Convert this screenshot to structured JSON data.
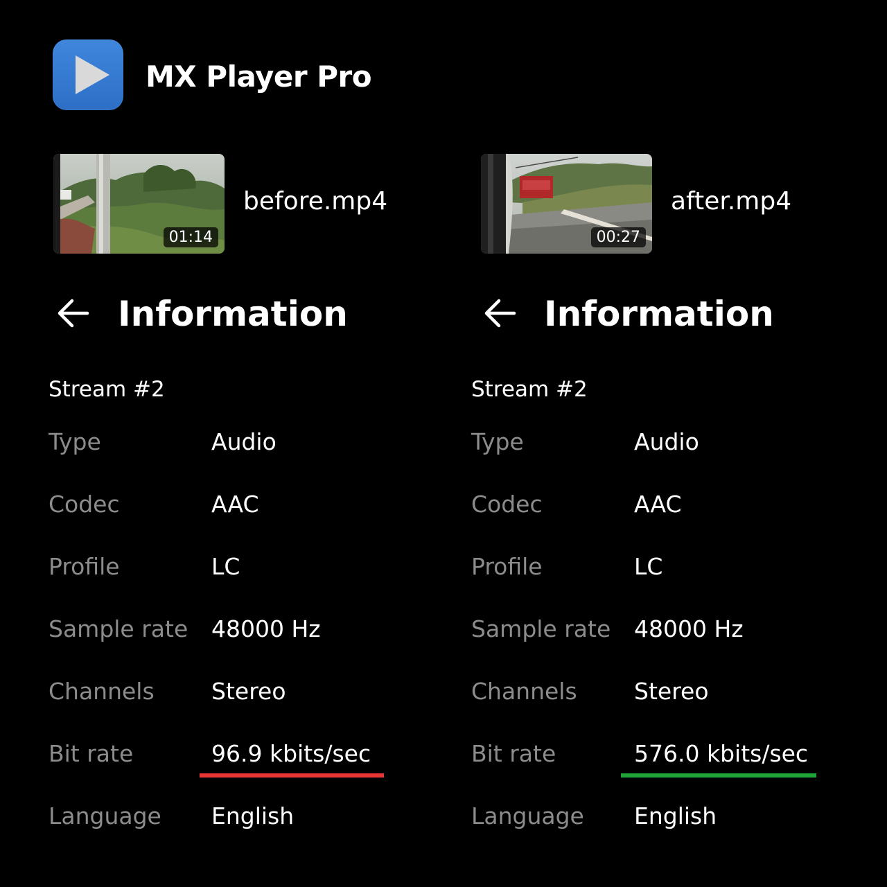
{
  "app": {
    "title": "MX Player Pro",
    "icon": "play-icon",
    "icon_color": "#3a7ed6"
  },
  "left": {
    "file_name": "before.mp4",
    "duration": "01:14",
    "header_title": "Information",
    "stream": "Stream #2",
    "rows": [
      {
        "label": "Type",
        "value": "Audio"
      },
      {
        "label": "Codec",
        "value": "AAC"
      },
      {
        "label": "Profile",
        "value": "LC"
      },
      {
        "label": "Sample rate",
        "value": "48000 Hz"
      },
      {
        "label": "Channels",
        "value": "Stereo"
      },
      {
        "label": "Bit rate",
        "value": "96.9 kbits/sec"
      },
      {
        "label": "Language",
        "value": "English"
      }
    ],
    "highlight_color": "#e83535"
  },
  "right": {
    "file_name": "after.mp4",
    "duration": "00:27",
    "header_title": "Information",
    "stream": "Stream #2",
    "rows": [
      {
        "label": "Type",
        "value": "Audio"
      },
      {
        "label": "Codec",
        "value": "AAC"
      },
      {
        "label": "Profile",
        "value": "LC"
      },
      {
        "label": "Sample rate",
        "value": "48000 Hz"
      },
      {
        "label": "Channels",
        "value": "Stereo"
      },
      {
        "label": "Bit rate",
        "value": "576.0 kbits/sec"
      },
      {
        "label": "Language",
        "value": "English"
      }
    ],
    "highlight_color": "#1fa43a"
  }
}
